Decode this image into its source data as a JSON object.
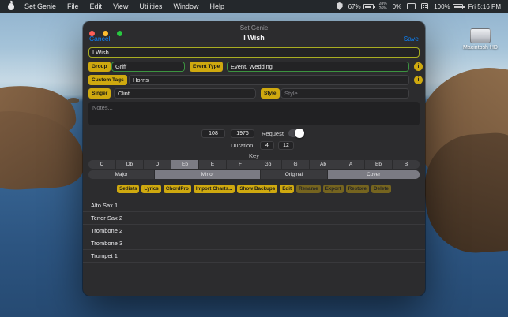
{
  "menu_bar": {
    "items": [
      "Set Genie",
      "File",
      "Edit",
      "View",
      "Utilities",
      "Window",
      "Help"
    ],
    "status": {
      "battery1_pct": "67%",
      "stack_top": "28%",
      "stack_bottom": "26%",
      "gpu_pct": "0%",
      "battery2_pct": "100%",
      "clock": "Fri 5:16 PM"
    }
  },
  "desktop": {
    "volume_label": "Macintosh HD"
  },
  "window": {
    "title": "Set Genie",
    "nav": {
      "cancel": "Cancel",
      "title": "I Wish",
      "save": "Save"
    },
    "form": {
      "song_title": "I Wish",
      "group_label": "Group",
      "group_value": "Griff",
      "event_type_label": "Event Type",
      "event_type_value": "Event, Wedding",
      "custom_tags_label": "Custom Tags",
      "custom_tags_value": "Horns",
      "singer_label": "Singer",
      "singer_value": "Clint",
      "style_label": "Style",
      "style_placeholder": "Style",
      "notes_placeholder": "Notes...",
      "info_button": "i",
      "tempo": "108",
      "year": "1976",
      "request_label": "Request",
      "duration_label": "Duration:",
      "duration_min": "4",
      "duration_sec": "12",
      "key_label": "Key"
    },
    "key_segments": [
      {
        "label": "C"
      },
      {
        "label": "Db"
      },
      {
        "label": "D"
      },
      {
        "label": "Eb",
        "selected": true
      },
      {
        "label": "E"
      },
      {
        "label": "F"
      },
      {
        "label": "Gb"
      },
      {
        "label": "G"
      },
      {
        "label": "Ab"
      },
      {
        "label": "A"
      },
      {
        "label": "Bb"
      },
      {
        "label": "B"
      }
    ],
    "mode_segments": [
      {
        "label": "Major"
      },
      {
        "label": "Minor",
        "selected": true
      },
      {
        "label": "Original"
      },
      {
        "label": "Cover",
        "selected": true
      }
    ],
    "action_buttons": [
      {
        "label": "Setlists"
      },
      {
        "label": "Lyrics"
      },
      {
        "label": "ChordPro"
      },
      {
        "label": "Import Charts..."
      },
      {
        "label": "Show Backups"
      },
      {
        "label": "Edit"
      },
      {
        "label": "Rename",
        "dim": true
      },
      {
        "label": "Export",
        "dim": true
      },
      {
        "label": "Restore",
        "dim": true
      },
      {
        "label": "Delete",
        "dim": true
      }
    ],
    "tracks": [
      "Alto Sax 1",
      "Tenor Sax 2",
      "Trombone 2",
      "Trombone 3",
      "Trumpet 1"
    ]
  },
  "colors": {
    "accent_yellow": "#cfa90f",
    "accent_blue": "#0a84ff",
    "field_green": "#3c9440",
    "title_field_border": "#a9ad21",
    "window_bg": "#2c2c2e"
  }
}
